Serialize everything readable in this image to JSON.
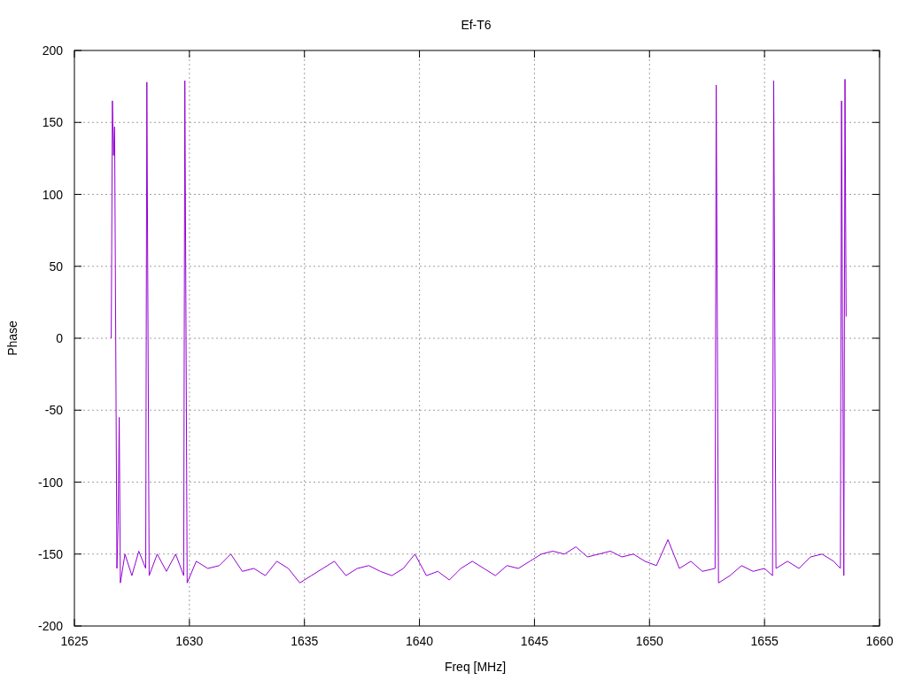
{
  "chart_data": {
    "type": "line",
    "title": "Ef-T6",
    "xlabel": "Freq [MHz]",
    "ylabel": "Phase",
    "xlim": [
      1625,
      1660
    ],
    "ylim": [
      -200,
      200
    ],
    "grid": true,
    "xticks": [
      1625,
      1630,
      1635,
      1640,
      1645,
      1650,
      1655,
      1660
    ],
    "yticks": [
      -200,
      -150,
      -100,
      -50,
      0,
      50,
      100,
      150,
      200
    ],
    "x": [
      1626.6,
      1626.62,
      1626.65,
      1626.7,
      1626.75,
      1626.8,
      1626.85,
      1626.9,
      1626.95,
      1627.0,
      1627.2,
      1627.5,
      1627.8,
      1628.1,
      1628.15,
      1628.2,
      1628.25,
      1628.6,
      1629.0,
      1629.4,
      1629.75,
      1629.8,
      1629.85,
      1629.9,
      1630.3,
      1630.8,
      1631.3,
      1631.8,
      1632.3,
      1632.8,
      1633.3,
      1633.8,
      1634.3,
      1634.8,
      1635.3,
      1635.8,
      1636.3,
      1636.8,
      1637.3,
      1637.8,
      1638.3,
      1638.8,
      1639.3,
      1639.8,
      1640.3,
      1640.8,
      1641.3,
      1641.8,
      1642.3,
      1642.8,
      1643.3,
      1643.8,
      1644.3,
      1644.8,
      1645.3,
      1645.8,
      1646.3,
      1646.8,
      1647.3,
      1647.8,
      1648.3,
      1648.8,
      1649.3,
      1649.8,
      1650.3,
      1650.8,
      1651.3,
      1651.8,
      1652.3,
      1652.85,
      1652.9,
      1652.95,
      1653.0,
      1653.5,
      1654.0,
      1654.5,
      1655.0,
      1655.35,
      1655.4,
      1655.45,
      1655.5,
      1656.0,
      1656.5,
      1657.0,
      1657.5,
      1658.0,
      1658.3,
      1658.35,
      1658.4,
      1658.45,
      1658.5,
      1658.55
    ],
    "series": [
      {
        "color": "#9400d3",
        "values": [
          0,
          60,
          165,
          127,
          147,
          -5,
          -160,
          -130,
          -55,
          -170,
          -150,
          -165,
          -148,
          -160,
          178,
          5,
          -165,
          -150,
          -162,
          -150,
          -165,
          179,
          8,
          -170,
          -155,
          -160,
          -158,
          -150,
          -162,
          -160,
          -165,
          -155,
          -160,
          -170,
          -165,
          -160,
          -155,
          -165,
          -160,
          -158,
          -162,
          -165,
          -160,
          -150,
          -165,
          -162,
          -168,
          -160,
          -155,
          -160,
          -165,
          -158,
          -160,
          -155,
          -150,
          -148,
          -150,
          -145,
          -152,
          -150,
          -148,
          -152,
          -150,
          -155,
          -158,
          -140,
          -160,
          -155,
          -162,
          -160,
          176,
          5,
          -170,
          -165,
          -158,
          -162,
          -160,
          -165,
          179,
          3,
          -160,
          -155,
          -160,
          -152,
          -150,
          -155,
          -160,
          165,
          -5,
          -165,
          180,
          15
        ]
      }
    ]
  }
}
